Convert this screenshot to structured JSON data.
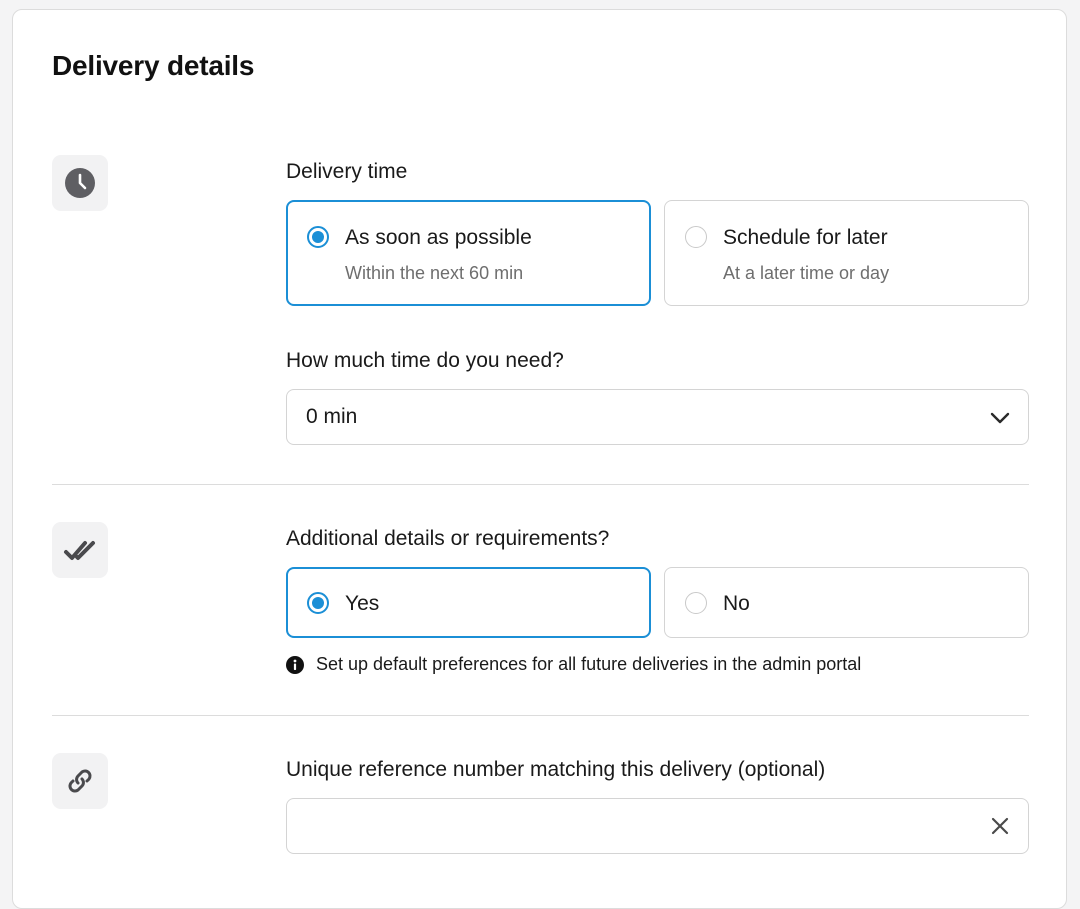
{
  "page": {
    "title": "Delivery details"
  },
  "delivery_time": {
    "label": "Delivery time",
    "options": [
      {
        "title": "As soon as possible",
        "subtitle": "Within the next 60 min",
        "selected": true
      },
      {
        "title": "Schedule for later",
        "subtitle": "At a later time or day",
        "selected": false
      }
    ],
    "prep_label": "How much time do you need?",
    "prep_value": "0 min",
    "icon": "clock-icon"
  },
  "requirements": {
    "label": "Additional details or requirements?",
    "options": [
      {
        "title": "Yes",
        "selected": true
      },
      {
        "title": "No",
        "selected": false
      }
    ],
    "info_text": "Set up default preferences for all future deliveries in the admin portal",
    "icon": "double-check-icon"
  },
  "reference": {
    "label": "Unique reference number matching this delivery (optional)",
    "value": "",
    "placeholder": "",
    "icon": "link-icon"
  },
  "colors": {
    "accent": "#1b8fd6",
    "border": "#d4d4d4",
    "icon_tile": "#f2f2f3",
    "muted_text": "#6e6e6e"
  }
}
